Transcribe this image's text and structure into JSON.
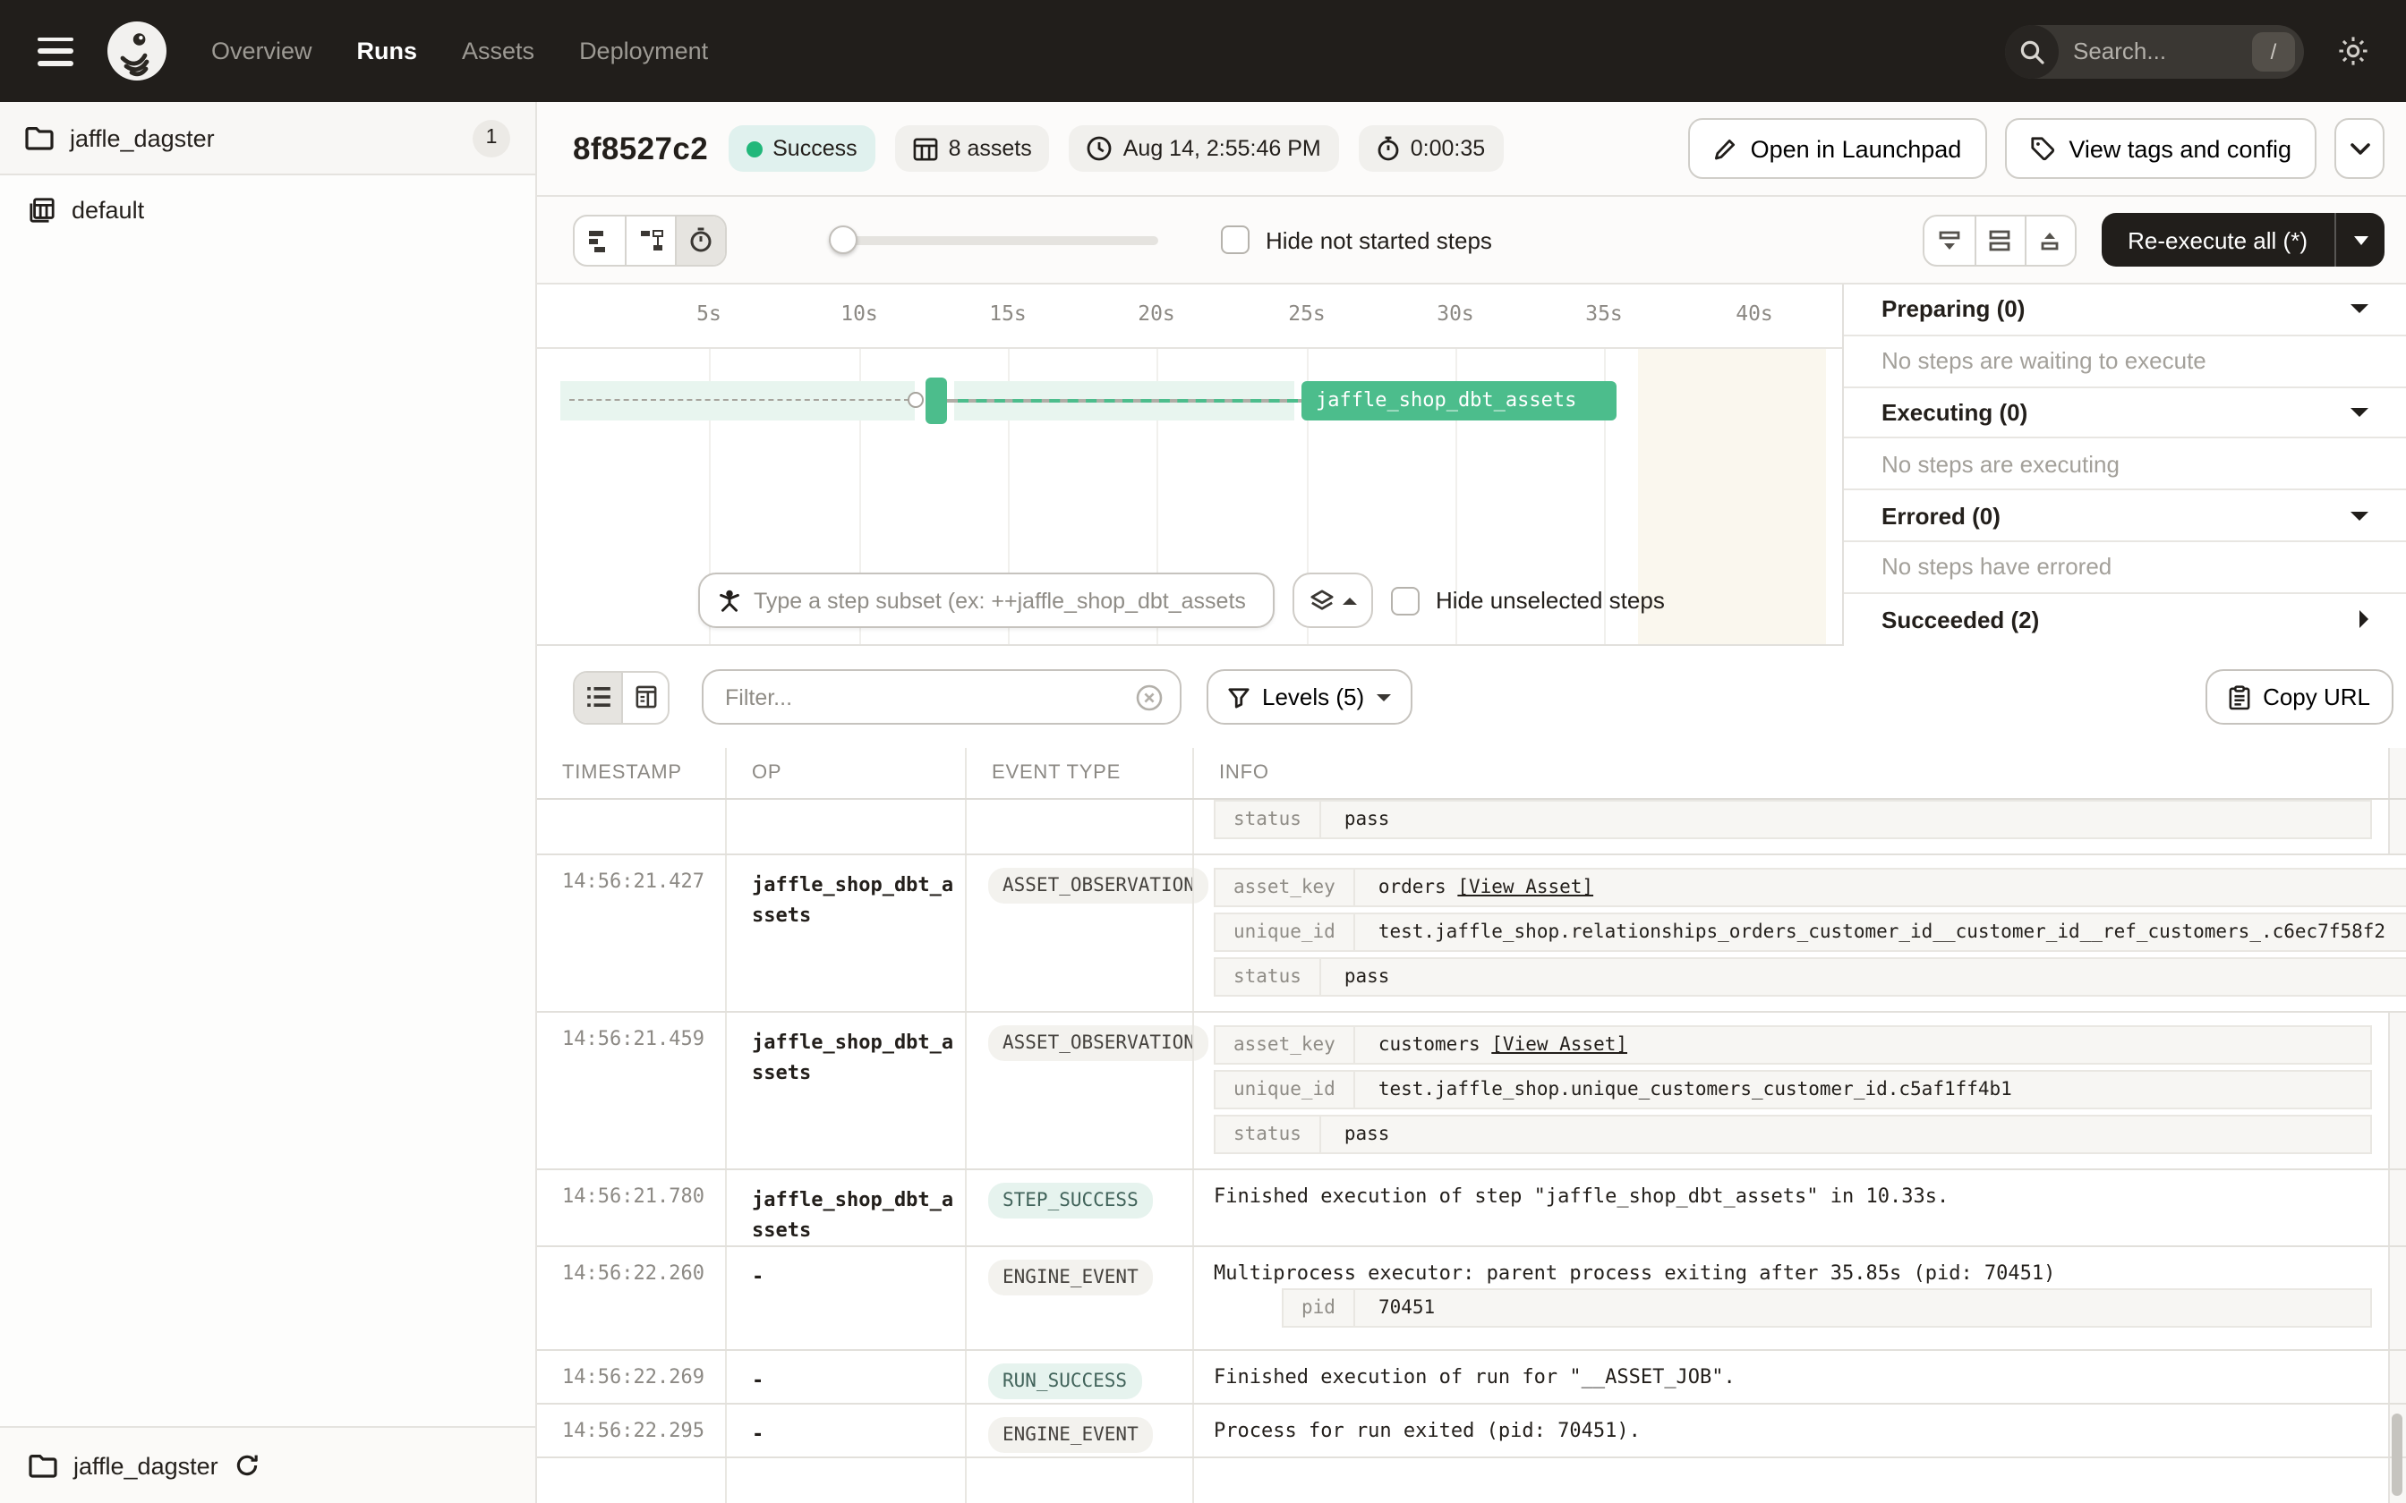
{
  "nav": {
    "links": [
      {
        "label": "Overview"
      },
      {
        "label": "Runs"
      },
      {
        "label": "Assets"
      },
      {
        "label": "Deployment"
      }
    ],
    "search": {
      "placeholder": "Search...",
      "shortcut": "/"
    }
  },
  "sidebar": {
    "top": {
      "label": "jaffle_dagster",
      "badge": "1"
    },
    "items": [
      {
        "label": "default"
      }
    ],
    "footer": {
      "label": "jaffle_dagster"
    }
  },
  "run": {
    "id": "8f8527c2",
    "status": "Success",
    "assets": "8 assets",
    "timestamp": "Aug 14, 2:55:46 PM",
    "duration": "0:00:35",
    "actions": {
      "launchpad": "Open in Launchpad",
      "tags": "View tags and config"
    }
  },
  "gantt": {
    "hide_not_started": "Hide not started steps",
    "reexecute": "Re-execute all (*)",
    "ticks": [
      "5s",
      "10s",
      "15s",
      "20s",
      "25s",
      "30s",
      "35s",
      "40s"
    ],
    "bar_label": "jaffle_shop_dbt_assets",
    "subset_placeholder": "Type a step subset (ex: ++jaffle_shop_dbt_assets",
    "hide_unselected": "Hide unselected steps"
  },
  "panel": {
    "sections": [
      {
        "title": "Preparing (0)",
        "body": "No steps are waiting to execute"
      },
      {
        "title": "Executing (0)",
        "body": "No steps are executing"
      },
      {
        "title": "Errored (0)",
        "body": "No steps have errored"
      },
      {
        "title": "Succeeded (2)",
        "body": ""
      }
    ]
  },
  "logs": {
    "filter_placeholder": "Filter...",
    "levels": "Levels (5)",
    "copy_url": "Copy URL",
    "columns": [
      "TIMESTAMP",
      "OP",
      "EVENT TYPE",
      "INFO"
    ],
    "rows": [
      {
        "timestamp": "",
        "op": "",
        "event_type": "",
        "kv": [
          {
            "k": "status",
            "v": "pass"
          }
        ]
      },
      {
        "timestamp": "14:56:21.427",
        "op": "jaffle_shop_dbt_assets",
        "event_type": "ASSET_OBSERVATION",
        "kv": [
          {
            "k": "asset_key",
            "v": "orders",
            "link": "[View Asset]"
          },
          {
            "k": "unique_id",
            "v": "test.jaffle_shop.relationships_orders_customer_id__customer_id__ref_customers_.c6ec7f58f2"
          },
          {
            "k": "status",
            "v": "pass"
          }
        ]
      },
      {
        "timestamp": "14:56:21.459",
        "op": "jaffle_shop_dbt_assets",
        "event_type": "ASSET_OBSERVATION",
        "kv": [
          {
            "k": "asset_key",
            "v": "customers",
            "link": "[View Asset]"
          },
          {
            "k": "unique_id",
            "v": "test.jaffle_shop.unique_customers_customer_id.c5af1ff4b1"
          },
          {
            "k": "status",
            "v": "pass"
          }
        ]
      },
      {
        "timestamp": "14:56:21.780",
        "op": "jaffle_shop_dbt_assets",
        "event_type": "STEP_SUCCESS",
        "message": "Finished execution of step \"jaffle_shop_dbt_assets\" in 10.33s."
      },
      {
        "timestamp": "14:56:22.260",
        "op": "-",
        "event_type": "ENGINE_EVENT",
        "message": "Multiprocess executor: parent process exiting after 35.85s (pid: 70451)",
        "kv": [
          {
            "k": "pid",
            "v": "70451"
          }
        ]
      },
      {
        "timestamp": "14:56:22.269",
        "op": "-",
        "event_type": "RUN_SUCCESS",
        "message": "Finished execution of run for \"__ASSET_JOB\"."
      },
      {
        "timestamp": "14:56:22.295",
        "op": "-",
        "event_type": "ENGINE_EVENT",
        "message": "Process for run exited (pid: 70451)."
      }
    ]
  },
  "colors": {
    "accent_green": "#4cbd8c",
    "success_dot": "#21b77a",
    "nav_bg": "#211e1b"
  }
}
